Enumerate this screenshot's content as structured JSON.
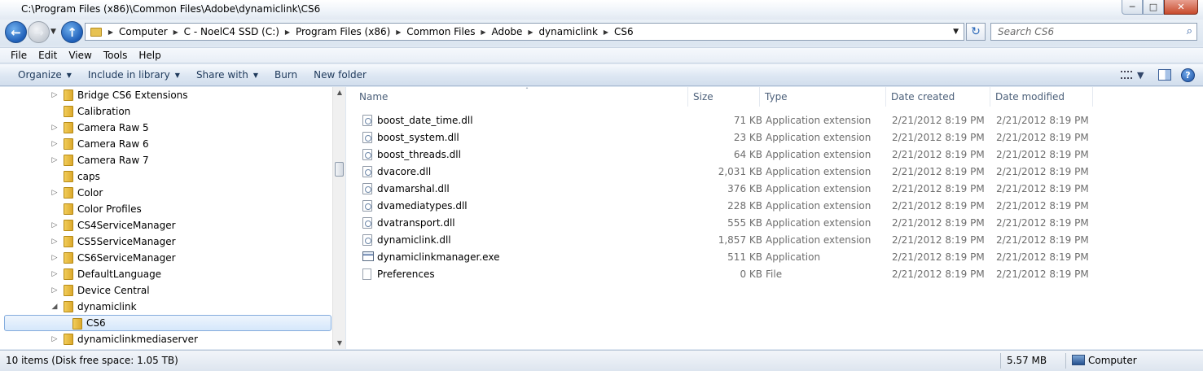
{
  "window": {
    "title": "C:\\Program Files (x86)\\Common Files\\Adobe\\dynamiclink\\CS6",
    "minimize": "─",
    "maximize": "□",
    "close": "✕"
  },
  "nav": {
    "back_icon": "back-arrow-icon",
    "forward_icon": "forward-arrow-icon",
    "up_icon": "up-arrow-icon",
    "back_glyph": "←",
    "forward_glyph": "→",
    "up_glyph": "↑",
    "history_glyph": "▼"
  },
  "address": {
    "breadcrumbs": [
      "Computer",
      "C - NoelC4 SSD (C:)",
      "Program Files (x86)",
      "Common Files",
      "Adobe",
      "dynamiclink",
      "CS6"
    ],
    "separator": "▶",
    "dropdown_glyph": "▼",
    "refresh_glyph": "↻"
  },
  "search": {
    "placeholder": "Search CS6",
    "icon_glyph": "⌕"
  },
  "menu": [
    "File",
    "Edit",
    "View",
    "Tools",
    "Help"
  ],
  "commands": [
    {
      "label": "Organize",
      "dropdown": true
    },
    {
      "label": "Include in library",
      "dropdown": true
    },
    {
      "label": "Share with",
      "dropdown": true
    },
    {
      "label": "Burn",
      "dropdown": false
    },
    {
      "label": "New folder",
      "dropdown": false
    }
  ],
  "command_right": {
    "views_dropdown": "▼",
    "help_glyph": "?"
  },
  "tree": [
    {
      "label": "Bridge CS6 Extensions",
      "expandable": true
    },
    {
      "label": "Calibration",
      "expandable": false
    },
    {
      "label": "Camera Raw 5",
      "expandable": true
    },
    {
      "label": "Camera Raw 6",
      "expandable": true
    },
    {
      "label": "Camera Raw 7",
      "expandable": true
    },
    {
      "label": "caps",
      "expandable": false
    },
    {
      "label": "Color",
      "expandable": true
    },
    {
      "label": "Color Profiles",
      "expandable": false
    },
    {
      "label": "CS4ServiceManager",
      "expandable": true
    },
    {
      "label": "CS5ServiceManager",
      "expandable": true
    },
    {
      "label": "CS6ServiceManager",
      "expandable": true
    },
    {
      "label": "DefaultLanguage",
      "expandable": true
    },
    {
      "label": "Device Central",
      "expandable": true
    },
    {
      "label": "dynamiclink",
      "expandable": true,
      "expanded": true
    },
    {
      "label": "CS6",
      "expandable": false,
      "selected": true,
      "child": true
    },
    {
      "label": "dynamiclinkmediaserver",
      "expandable": true
    }
  ],
  "tree_glyphs": {
    "collapsed": "▷",
    "expanded": "◢",
    "scroll_up": "▲",
    "scroll_down": "▼"
  },
  "columns": {
    "name": "Name",
    "size": "Size",
    "type": "Type",
    "created": "Date created",
    "modified": "Date modified",
    "sort_glyph": "ˆ"
  },
  "files": [
    {
      "name": "boost_date_time.dll",
      "size": "71 KB",
      "type": "Application extension",
      "created": "2/21/2012 8:19 PM",
      "modified": "2/21/2012 8:19 PM",
      "icon": "dll"
    },
    {
      "name": "boost_system.dll",
      "size": "23 KB",
      "type": "Application extension",
      "created": "2/21/2012 8:19 PM",
      "modified": "2/21/2012 8:19 PM",
      "icon": "dll"
    },
    {
      "name": "boost_threads.dll",
      "size": "64 KB",
      "type": "Application extension",
      "created": "2/21/2012 8:19 PM",
      "modified": "2/21/2012 8:19 PM",
      "icon": "dll"
    },
    {
      "name": "dvacore.dll",
      "size": "2,031 KB",
      "type": "Application extension",
      "created": "2/21/2012 8:19 PM",
      "modified": "2/21/2012 8:19 PM",
      "icon": "dll"
    },
    {
      "name": "dvamarshal.dll",
      "size": "376 KB",
      "type": "Application extension",
      "created": "2/21/2012 8:19 PM",
      "modified": "2/21/2012 8:19 PM",
      "icon": "dll"
    },
    {
      "name": "dvamediatypes.dll",
      "size": "228 KB",
      "type": "Application extension",
      "created": "2/21/2012 8:19 PM",
      "modified": "2/21/2012 8:19 PM",
      "icon": "dll"
    },
    {
      "name": "dvatransport.dll",
      "size": "555 KB",
      "type": "Application extension",
      "created": "2/21/2012 8:19 PM",
      "modified": "2/21/2012 8:19 PM",
      "icon": "dll"
    },
    {
      "name": "dynamiclink.dll",
      "size": "1,857 KB",
      "type": "Application extension",
      "created": "2/21/2012 8:19 PM",
      "modified": "2/21/2012 8:19 PM",
      "icon": "dll"
    },
    {
      "name": "dynamiclinkmanager.exe",
      "size": "511 KB",
      "type": "Application",
      "created": "2/21/2012 8:19 PM",
      "modified": "2/21/2012 8:19 PM",
      "icon": "exe"
    },
    {
      "name": "Preferences",
      "size": "0 KB",
      "type": "File",
      "created": "2/21/2012 8:19 PM",
      "modified": "2/21/2012 8:19 PM",
      "icon": "file"
    }
  ],
  "status": {
    "count": "10 items (Disk free space: 1.05 TB)",
    "size": "5.57 MB",
    "location": "Computer"
  }
}
